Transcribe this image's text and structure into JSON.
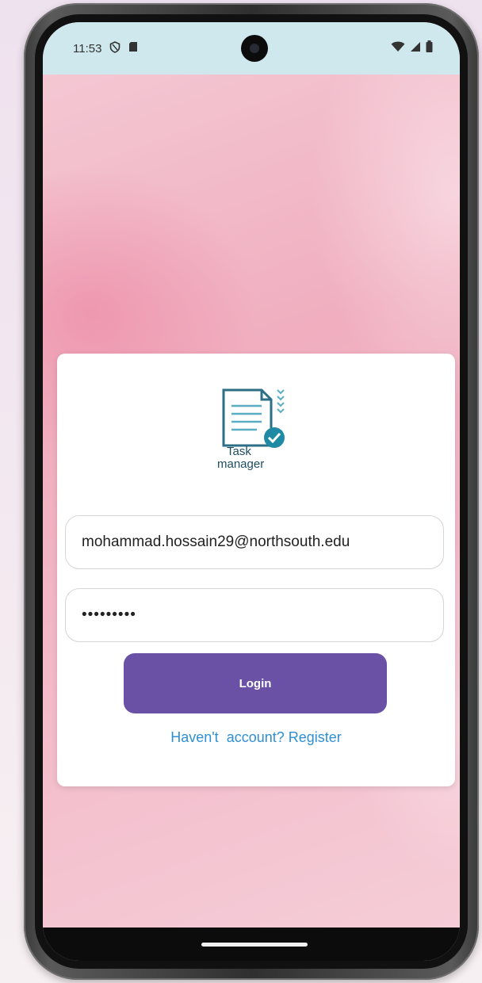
{
  "status_bar": {
    "time": "11:53",
    "left_icons": [
      "shield-icon",
      "sd-card-icon"
    ],
    "right_icons": [
      "wifi-icon",
      "signal-icon",
      "battery-icon"
    ]
  },
  "logo": {
    "line1": "Task",
    "line2": "manager"
  },
  "login_form": {
    "email_value": "mohammad.hossain29@northsouth.edu",
    "password_value": "•••••••••",
    "login_label": "Login",
    "register_text": "Haven't  account? Register"
  },
  "colors": {
    "primary_button": "#6a51a6",
    "link": "#2f8fd4",
    "status_bar_bg": "#cfe8ee",
    "logo_check": "#1f8aa3"
  }
}
